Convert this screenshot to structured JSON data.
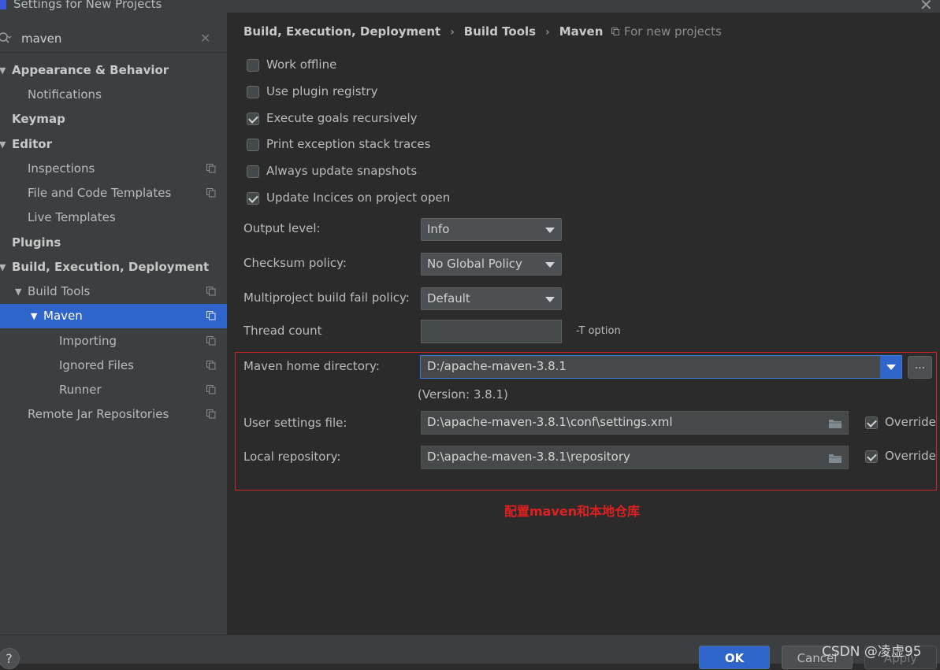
{
  "window": {
    "title": "Settings for New Projects",
    "close_glyph": "✕"
  },
  "search": {
    "value": "maven",
    "clear_glyph": "✕"
  },
  "tree": [
    {
      "label": "Appearance & Behavior",
      "bold": true,
      "expanded": true
    },
    {
      "label": "Notifications",
      "bold": false
    },
    {
      "label": "Keymap",
      "bold": true
    },
    {
      "label": "Editor",
      "bold": true,
      "expanded": true
    },
    {
      "label": "Inspections",
      "bold": false,
      "project_icon": true
    },
    {
      "label": "File and Code Templates",
      "bold": false,
      "project_icon": true
    },
    {
      "label": "Live Templates",
      "bold": false
    },
    {
      "label": "Plugins",
      "bold": true
    },
    {
      "label": "Build, Execution, Deployment",
      "bold": true,
      "expanded": true
    },
    {
      "label": "Build Tools",
      "bold": false,
      "expanded": true,
      "project_icon": true
    },
    {
      "label": "Maven",
      "bold": false,
      "expanded": true,
      "selected": true,
      "project_icon": true
    },
    {
      "label": "Importing",
      "bold": false,
      "project_icon": true
    },
    {
      "label": "Ignored Files",
      "bold": false,
      "project_icon": true
    },
    {
      "label": "Runner",
      "bold": false,
      "project_icon": true
    },
    {
      "label": "Remote Jar Repositories",
      "bold": false,
      "project_icon": true
    }
  ],
  "breadcrumb": {
    "items": [
      "Build, Execution, Deployment",
      "Build Tools",
      "Maven"
    ],
    "separator": "›",
    "scope_label": "For new projects"
  },
  "options": {
    "work_offline": {
      "label": "Work offline",
      "checked": false
    },
    "use_plugin_registry": {
      "label": "Use plugin registry",
      "checked": false
    },
    "execute_goals_recursively": {
      "label": "Execute goals recursively",
      "checked": true
    },
    "print_exception_stack_traces": {
      "label": "Print exception stack traces",
      "checked": false
    },
    "always_update_snapshots": {
      "label": "Always update snapshots",
      "checked": false
    },
    "update_indices": {
      "label": "Update Incices on project open",
      "checked": true
    }
  },
  "form": {
    "output_level": {
      "label": "Output level:",
      "value": "Info"
    },
    "checksum_policy": {
      "label": "Checksum policy:",
      "value": "No Global Policy"
    },
    "multiproject_fail_policy": {
      "label": "Multiproject build fail policy:",
      "value": "Default"
    },
    "thread_count": {
      "label": "Thread count",
      "value": "",
      "hint": "-T option"
    },
    "maven_home": {
      "label": "Maven home directory:",
      "value": "D:/apache-maven-3.8.1",
      "version": "(Version: 3.8.1)",
      "browse_label": "..."
    },
    "user_settings": {
      "label": "User settings file:",
      "value": "D:\\apache-maven-3.8.1\\conf\\settings.xml",
      "override_label": "Override",
      "override_checked": true
    },
    "local_repository": {
      "label": "Local repository:",
      "value": "D:\\apache-maven-3.8.1\\repository",
      "override_label": "Override",
      "override_checked": true
    }
  },
  "annotation": "配置maven和本地仓库",
  "buttons": {
    "help": "?",
    "ok": "OK",
    "cancel": "Cancel",
    "apply": "Apply"
  },
  "watermark": "CSDN @凌虚95",
  "colors": {
    "background": "#2b2b2b",
    "panel": "#3c3f41",
    "selection": "#2f65ca",
    "highlight_border": "#d3262a",
    "annotation": "#e02020"
  }
}
